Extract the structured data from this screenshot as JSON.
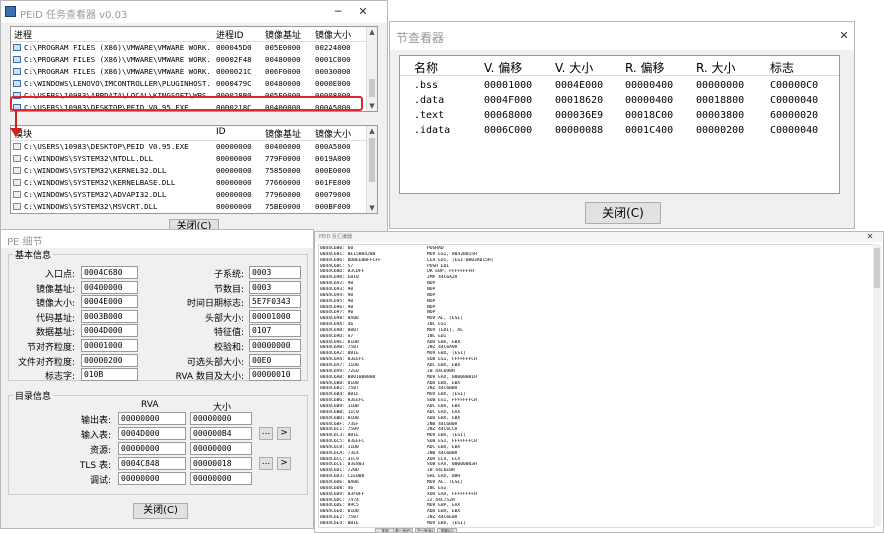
{
  "peid_window": {
    "title": "PEiD 任务查看器 v0.03",
    "process_header": [
      "进程",
      "进程ID",
      "镜像基址",
      "镜像大小"
    ],
    "processes": [
      {
        "path": "C:\\PROGRAM FILES (X86)\\VMWARE\\VMWARE WORK...",
        "pid": "000045D0",
        "base": "005E0000",
        "size": "00224000"
      },
      {
        "path": "C:\\PROGRAM FILES (X86)\\VMWARE\\VMWARE WORK...",
        "pid": "00002F48",
        "base": "00480000",
        "size": "0001C000"
      },
      {
        "path": "C:\\PROGRAM FILES (X86)\\VMWARE\\VMWARE WORK...",
        "pid": "0000021C",
        "base": "006F0000",
        "size": "00030000"
      },
      {
        "path": "C:\\WINDOWS\\LENOVO\\IMCONTROLLER\\PLUGINHOST...",
        "pid": "0000479C",
        "base": "00480000",
        "size": "0000E000"
      },
      {
        "path": "C:\\USERS\\10983\\APPDATA\\LOCAL\\KINGSOFT\\WPS...",
        "pid": "000028B0",
        "base": "005E0000",
        "size": "00008000"
      },
      {
        "path": "C:\\USERS\\10983\\DESKTOP\\PEID V0.95.EXE",
        "pid": "0000218C",
        "base": "00400000",
        "size": "000A5000"
      }
    ],
    "module_header": [
      "模块",
      "ID",
      "镜像基址",
      "镜像大小"
    ],
    "modules": [
      {
        "path": "C:\\USERS\\10983\\DESKTOP\\PEID V0.95.EXE",
        "id": "00000000",
        "base": "00400000",
        "size": "000A5000"
      },
      {
        "path": "C:\\WINDOWS\\SYSTEM32\\NTDLL.DLL",
        "id": "00000000",
        "base": "779F0000",
        "size": "0019A000"
      },
      {
        "path": "C:\\WINDOWS\\SYSTEM32\\KERNEL32.DLL",
        "id": "00000000",
        "base": "75850000",
        "size": "000E0000"
      },
      {
        "path": "C:\\WINDOWS\\SYSTEM32\\KERNELBASE.DLL",
        "id": "00000000",
        "base": "77660000",
        "size": "001FE000"
      },
      {
        "path": "C:\\WINDOWS\\SYSTEM32\\ADVAPI32.DLL",
        "id": "00000000",
        "base": "77960000",
        "size": "00079000"
      },
      {
        "path": "C:\\WINDOWS\\SYSTEM32\\MSVCRT.DLL",
        "id": "00000000",
        "base": "75BE0000",
        "size": "000BF000"
      }
    ],
    "close_label": "关闭(C)"
  },
  "section_window": {
    "title": "节查看器",
    "header": [
      "名称",
      "V. 偏移",
      "V. 大小",
      "R. 偏移",
      "R. 大小",
      "标志"
    ],
    "rows": [
      [
        ".bss",
        "00001000",
        "0004E000",
        "00000400",
        "00000000",
        "C00000C0"
      ],
      [
        ".data",
        "0004F000",
        "00018620",
        "00000400",
        "00018800",
        "C0000040"
      ],
      [
        ".text",
        "00068000",
        "000036E9",
        "00018C00",
        "00003800",
        "60000020"
      ],
      [
        ".idata",
        "0006C000",
        "00000088",
        "0001C400",
        "00000200",
        "C0000040"
      ]
    ],
    "close_label": "关闭(C)"
  },
  "pe_window": {
    "title": "PE 细节",
    "basic_group": "基本信息",
    "left_fields": [
      {
        "label": "入口点:",
        "value": "0004C680"
      },
      {
        "label": "镜像基址:",
        "value": "00400000"
      },
      {
        "label": "镜像大小:",
        "value": "0004E000"
      },
      {
        "label": "代码基址:",
        "value": "0003B000"
      },
      {
        "label": "数据基址:",
        "value": "0004D000"
      },
      {
        "label": "节对齐粒度:",
        "value": "00001000"
      },
      {
        "label": "文件对齐粒度:",
        "value": "00000200"
      },
      {
        "label": "标志字:",
        "value": "010B"
      }
    ],
    "right_fields": [
      {
        "label": "子系统:",
        "value": "0003"
      },
      {
        "label": "节数目:",
        "value": "0003"
      },
      {
        "label": "时间日期标志:",
        "value": "5E7F0343"
      },
      {
        "label": "头部大小:",
        "value": "00001000"
      },
      {
        "label": "特征值:",
        "value": "0107"
      },
      {
        "label": "校验和:",
        "value": "00000000"
      },
      {
        "label": "可选头部大小:",
        "value": "00E0"
      },
      {
        "label": "RVA 数目及大小:",
        "value": "00000010"
      }
    ],
    "dir_group": "目录信息",
    "dir_header": [
      "RVA",
      "大小"
    ],
    "dirs": [
      {
        "label": "输出表:",
        "rva": "00000000",
        "size": "00000000"
      },
      {
        "label": "输入表:",
        "rva": "0004D000",
        "size": "000000B4"
      },
      {
        "label": "资源:",
        "rva": "00000000",
        "size": "00000000"
      },
      {
        "label": "TLS 表:",
        "rva": "0004C848",
        "size": "00000018"
      },
      {
        "label": "调试:",
        "rva": "00000000",
        "size": "00000000"
      }
    ],
    "more_label": "...",
    "next_label": ">",
    "close_label": "关闭(C)"
  },
  "disasm_window": {
    "title": "PEiD 反汇编器",
    "rows": [
      [
        "0044C680: 60",
        "PUSHAD"
      ],
      [
        "0044C681: BE15B04200",
        "MOV ESI, 0042B015H"
      ],
      [
        "0044C686: 8DBEEBBFFCFF",
        "LEA EDI, [ESI-0003A015H]"
      ],
      [
        "0044C68C: 57",
        "PUSH EDI"
      ],
      [
        "0044C68D: 83CDFF",
        "OR EBP, FFFFFFFFH"
      ],
      [
        "0044C690: EB10",
        "JMP 44C6A2H"
      ],
      [
        "0044C692: 90",
        "NOP"
      ],
      [
        "0044C693: 90",
        "NOP"
      ],
      [
        "0044C694: 90",
        "NOP"
      ],
      [
        "0044C695: 90",
        "NOP"
      ],
      [
        "0044C696: 90",
        "NOP"
      ],
      [
        "0044C697: 90",
        "NOP"
      ],
      [
        "0044C698: 8A06",
        "MOV AL, [ESI]"
      ],
      [
        "0044C69A: 46",
        "INC ESI"
      ],
      [
        "0044C69B: 8807",
        "MOV [EDI], AL"
      ],
      [
        "0044C69D: 47",
        "INC EDI"
      ],
      [
        "0044C69E: 01DB",
        "ADD EBX, EBX"
      ],
      [
        "0044C6A0: 7507",
        "JNZ 44C6A9H"
      ],
      [
        "0044C6A2: 8B1E",
        "MOV EBX, [ESI]"
      ],
      [
        "0044C6A4: 83EEFC",
        "SUB ESI, FFFFFFFCH"
      ],
      [
        "0044C6A7: 11DB",
        "ADC EBX, EBX"
      ],
      [
        "0044C6A9: 72ED",
        "JB 44C698H"
      ],
      [
        "0044C6AB: B801000000",
        "MOV EAX, 00000001H"
      ],
      [
        "0044C6B0: 01DB",
        "ADD EBX, EBX"
      ],
      [
        "0044C6B2: 7507",
        "JNZ 44C6BBH"
      ],
      [
        "0044C6B4: 8B1E",
        "MOV EBX, [ESI]"
      ],
      [
        "0044C6B6: 83EEFC",
        "SUB ESI, FFFFFFFCH"
      ],
      [
        "0044C6B9: 11DB",
        "ADC EBX, EBX"
      ],
      [
        "0044C6BB: 11C0",
        "ADC EAX, EAX"
      ],
      [
        "0044C6BD: 01DB",
        "ADD EBX, EBX"
      ],
      [
        "0044C6BF: 73EF",
        "JNB 44C6B0H"
      ],
      [
        "0044C6C1: 7509",
        "JNZ 44C6CCH"
      ],
      [
        "0044C6C3: 8B1E",
        "MOV EBX, [ESI]"
      ],
      [
        "0044C6C5: 83EEFC",
        "SUB ESI, FFFFFFFCH"
      ],
      [
        "0044C6C8: 11DB",
        "ADC EBX, EBX"
      ],
      [
        "0044C6CA: 73E4",
        "JNB 44C6B0H"
      ],
      [
        "0044C6CC: 31C9",
        "XOR ECX, ECX"
      ],
      [
        "0044C6CE: 83E803",
        "SUB EAX, 00000003H"
      ],
      [
        "0044C6D1: 720D",
        "JB 44C6E0H"
      ],
      [
        "0044C6D3: C1E008",
        "SHL EAX, 08H"
      ],
      [
        "0044C6D6: 8A06",
        "MOV AL, [ESI]"
      ],
      [
        "0044C6D8: 46",
        "INC ESI"
      ],
      [
        "0044C6D9: 83F0FF",
        "XOR EAX, FFFFFFFFH"
      ],
      [
        "0044C6DC: 7474",
        "JZ 44C752H"
      ],
      [
        "0044C6DE: 89C5",
        "MOV EBP, EAX"
      ],
      [
        "0044C6E0: 01DB",
        "ADD EBX, EBX"
      ],
      [
        "0044C6E2: 7507",
        "JNZ 44C6EBH"
      ],
      [
        "0044C6E4: 8B1E",
        "MOV EBX, [ESI]"
      ]
    ],
    "bottom_buttons": [
      "关闭",
      "前一页(P)",
      "下一页(N)",
      "复制(C)"
    ]
  }
}
